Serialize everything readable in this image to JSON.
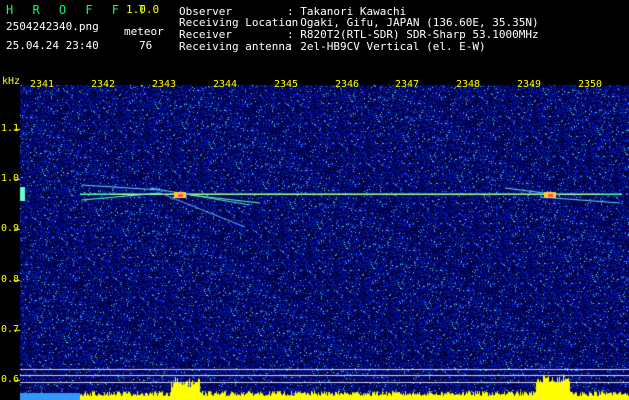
{
  "header": {
    "brand": "H R O F F T",
    "version": "1.0.0",
    "filename": "2504242340.png",
    "datetime": "25.04.24 23:40",
    "meteor_label": "meteor",
    "meteor_count": "76",
    "fields": [
      {
        "label": "Observer",
        "value": ": Takanori Kawachi"
      },
      {
        "label": "Receiving Location",
        "value": ": Ogaki, Gifu, JAPAN (136.60E, 35.35N)"
      },
      {
        "label": "Receiver",
        "value": ": R820T2(RTL-SDR) SDR-Sharp 53.1000MHz"
      },
      {
        "label": "Receiving antenna",
        "value": ": 2el-HB9CV Vertical (el. E-W)"
      }
    ]
  },
  "chart_data": {
    "type": "heatmap",
    "ylabel": "kHz",
    "x_ticks": [
      "2341",
      "2342",
      "2343",
      "2344",
      "2345",
      "2346",
      "2347",
      "2348",
      "2349",
      "2350"
    ],
    "y_ticks": [
      "1.1",
      "1.0",
      "0.9",
      "0.8",
      "0.7",
      "0.6"
    ],
    "ylim": [
      0.6,
      1.1
    ]
  }
}
